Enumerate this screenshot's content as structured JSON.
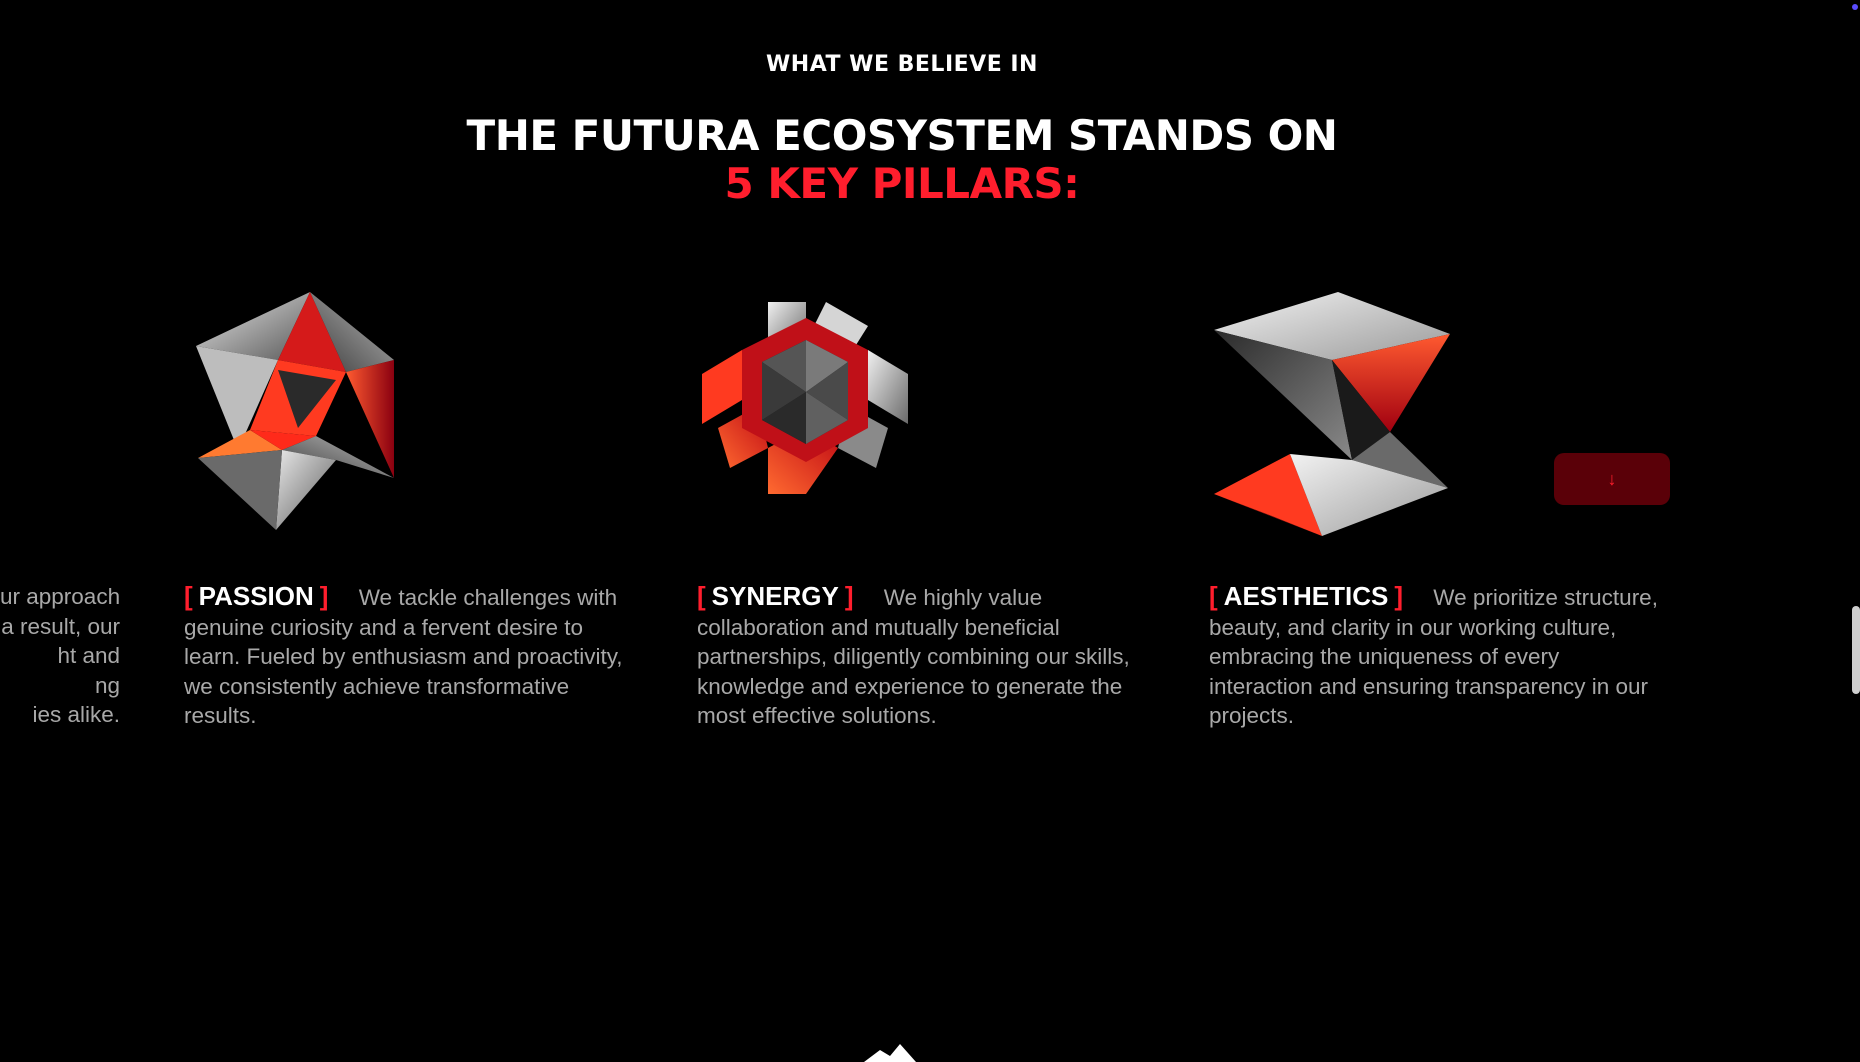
{
  "header": {
    "eyebrow": "WHAT WE BELIEVE IN",
    "title_line1": "THE FUTURA ECOSYSTEM STANDS ON",
    "title_line2": "5 KEY PILLARS:"
  },
  "colors": {
    "accent": "#ff1e2d",
    "background": "#000000",
    "body_text": "#a8a8a8"
  },
  "partial_pillar": {
    "lines": [
      "ur approach",
      "a result, our",
      "ht and",
      "ng",
      "ies alike."
    ]
  },
  "pillars": [
    {
      "bracket_open": "[",
      "name": "PASSION",
      "bracket_close": "]",
      "description": "We tackle challenges with genuine curiosity and a fervent desire to learn. Fueled by enthusiasm and proactivity, we consistently achieve transformative results.",
      "icon": "star-octahedron-icon"
    },
    {
      "bracket_open": "[",
      "name": "SYNERGY",
      "bracket_close": "]",
      "description": "We highly value collaboration and mutually beneficial partnerships, diligently combining our skills, knowledge and experience to generate the most effective solutions.",
      "icon": "hexagonal-cross-icon"
    },
    {
      "bracket_open": "[",
      "name": "AESTHETICS",
      "bracket_close": "]",
      "description": "We prioritize structure, beauty, and clarity in our working culture, embracing the uniqueness of every interaction and ensuring transparency in our projects.",
      "icon": "twisted-prism-icon"
    }
  ],
  "scroll_button": {
    "label": "↓",
    "icon": "arrow-down-icon"
  }
}
